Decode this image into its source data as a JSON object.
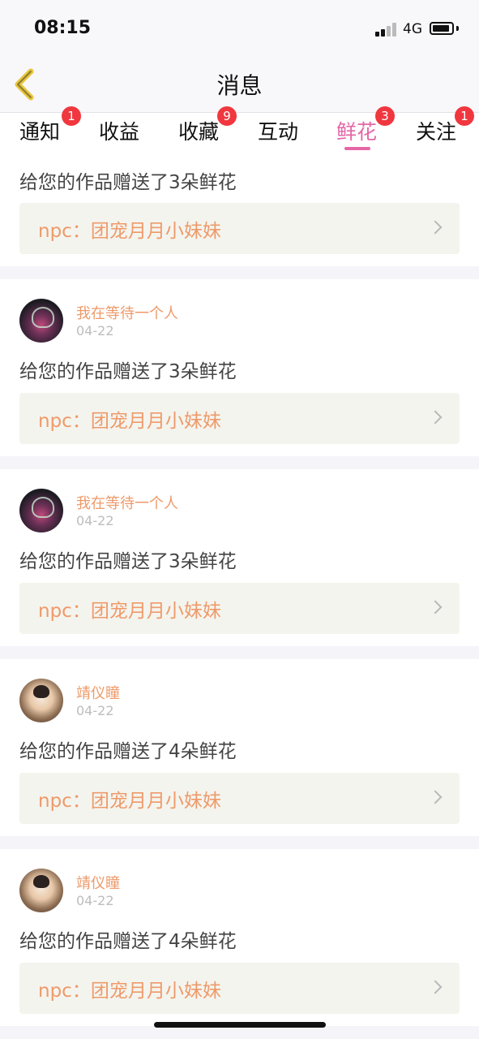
{
  "status": {
    "time": "08:15",
    "network": "4G"
  },
  "nav": {
    "title": "消息"
  },
  "tabs": [
    {
      "label": "通知",
      "badge": "1"
    },
    {
      "label": "收益",
      "badge": ""
    },
    {
      "label": "收藏",
      "badge": "9"
    },
    {
      "label": "互动",
      "badge": ""
    },
    {
      "label": "鲜花",
      "badge": "3",
      "active": true
    },
    {
      "label": "关注",
      "badge": "1"
    }
  ],
  "feed": [
    {
      "message": "给您的作品赠送了3朵鲜花",
      "work_title": "npc：团宠月月小妹妹"
    },
    {
      "username": "我在等待一个人",
      "date": "04-22",
      "message": "给您的作品赠送了3朵鲜花",
      "work_title": "npc：团宠月月小妹妹"
    },
    {
      "username": "我在等待一个人",
      "date": "04-22",
      "message": "给您的作品赠送了3朵鲜花",
      "work_title": "npc：团宠月月小妹妹"
    },
    {
      "username": "靖仪瞳",
      "date": "04-22",
      "message": "给您的作品赠送了4朵鲜花",
      "work_title": "npc：团宠月月小妹妹"
    },
    {
      "username": "靖仪瞳",
      "date": "04-22",
      "message": "给您的作品赠送了4朵鲜花",
      "work_title": "npc：团宠月月小妹妹"
    }
  ]
}
